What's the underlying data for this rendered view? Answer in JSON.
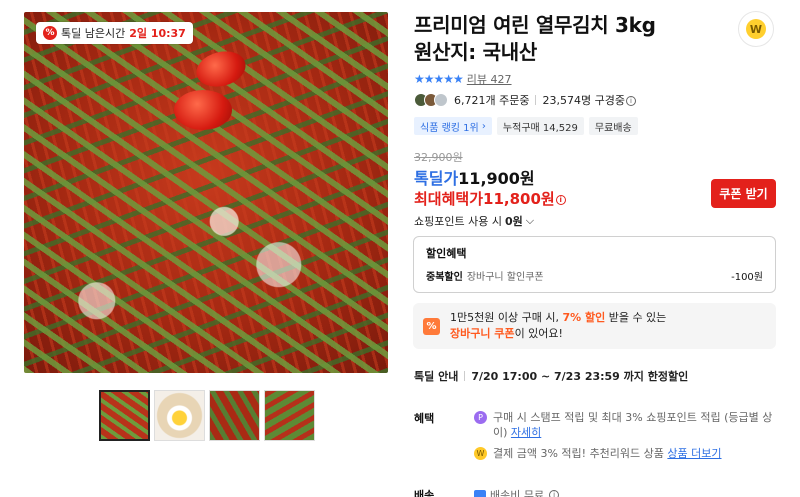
{
  "gallery": {
    "timer_label": "톡딜 남은시간",
    "timer_value": "2일 10:37",
    "thumbnails": [
      "kimchi-closeup",
      "kimchi-with-egg",
      "kimchi-bowl",
      "kimchi-dish"
    ]
  },
  "product": {
    "title_line1": "프리미엄 여린 열무김치 3kg",
    "title_line2": "원산지: 국내산"
  },
  "share": {
    "icon": "W"
  },
  "rating": {
    "stars": "★★★★★",
    "review_label": "리뷰 427"
  },
  "social": {
    "orders": "6,721개 주문중",
    "subscribers": "23,574명 구경중"
  },
  "tags": {
    "ranking": "식품 랭킹 1위",
    "cumulative": "누적구매 14,529",
    "shipping": "무료배송"
  },
  "price": {
    "original": "32,900원",
    "deal_label": "톡딜가",
    "deal_value": "11,900원",
    "max_label": "최대혜택가",
    "max_value": "11,800원",
    "coupon_button": "쿠폰 받기"
  },
  "points": {
    "label": "쇼핑포인트 사용 시",
    "value": "0원"
  },
  "discount": {
    "title": "할인혜택",
    "type": "중복할인",
    "desc": "장바구니 할인쿠폰",
    "amount": "-100원"
  },
  "promo": {
    "icon": "%",
    "text_a": "1만5천원 이상 구매 시,",
    "text_highlight1": "7% 할인",
    "text_b": "받을 수 있는",
    "text_highlight2": "장바구니 쿠폰",
    "text_c": "이 있어요!"
  },
  "schedule": {
    "label": "톡딜 안내",
    "value": "7/20 17:00 ~ 7/23 23:59 까지 한정할인"
  },
  "benefits": {
    "label": "혜택",
    "item1": "구매 시 스탬프 적립 및 최대 3% 쇼핑포인트 적립 (등급별 상이)",
    "item1_link": "자세히",
    "item2": "결제 금액 3% 적립! 추천리워드 상품",
    "item2_link": "상품 더보기"
  },
  "shipping": {
    "label": "배송",
    "value": "배송비 무료"
  }
}
